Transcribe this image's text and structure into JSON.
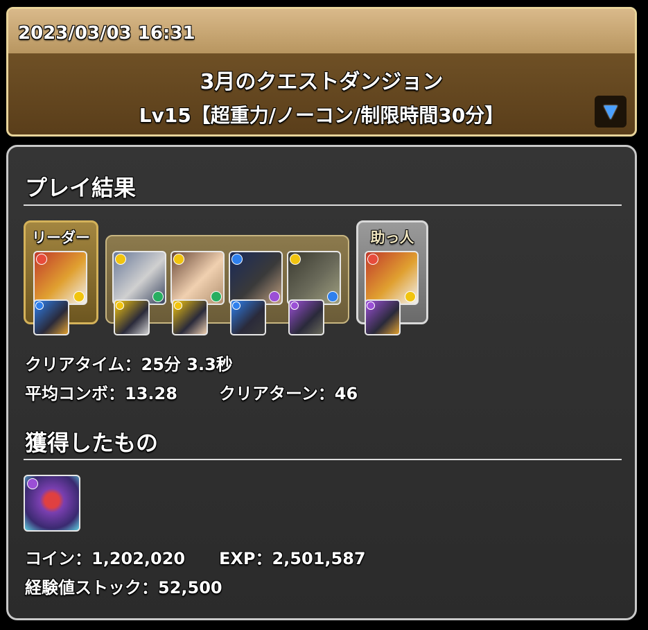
{
  "header": {
    "timestamp": "2023/03/03 16:31",
    "quest_title": "3月のクエストダンジョン",
    "quest_subtitle": "Lv15【超重力/ノーコン/制限時間30分】",
    "toggle_icon": "triangle-down-icon"
  },
  "play_result": {
    "title": "プレイ結果",
    "leader_label": "リーダー",
    "helper_label": "助っ人",
    "team": [
      {
        "role": "leader",
        "main_attr": "fire",
        "sub_attr": "light",
        "assist_attr": "water",
        "colors": [
          "#c0392b",
          "#e0a030",
          "#f0f0f0"
        ]
      },
      {
        "role": "sub",
        "main_attr": "light",
        "sub_attr": "wood",
        "assist_attr": "light",
        "colors": [
          "#6a7a9a",
          "#d0d0d0",
          "#3a4560"
        ]
      },
      {
        "role": "sub",
        "main_attr": "light",
        "sub_attr": "wood",
        "assist_attr": "light",
        "colors": [
          "#6b4a3a",
          "#f0d0b0",
          "#b09070"
        ]
      },
      {
        "role": "sub",
        "main_attr": "water",
        "sub_attr": "dark",
        "assist_attr": "water",
        "colors": [
          "#1a2a5a",
          "#3a3a3a",
          "#c0a080"
        ]
      },
      {
        "role": "sub",
        "main_attr": "light",
        "sub_attr": "water",
        "assist_attr": "dark",
        "colors": [
          "#3a3a30",
          "#6a6a5a",
          "#a0a080"
        ]
      },
      {
        "role": "helper",
        "main_attr": "fire",
        "sub_attr": "light",
        "assist_attr": "dark",
        "colors": [
          "#c0392b",
          "#e0a030",
          "#f0f0f0"
        ]
      }
    ],
    "stats": {
      "clear_time": "クリアタイム：25分 3.3秒",
      "avg_combo": "平均コンボ：13.28",
      "clear_turns": "クリアターン：46"
    }
  },
  "rewards": {
    "title": "獲得したもの",
    "drop_attr": "dark",
    "coins": "コイン：1,202,020",
    "exp": "EXP：2,501,587",
    "exp_stock": "経験値ストック：52,500"
  },
  "attr_colors": {
    "fire": "#e74c3c",
    "water": "#2f80ed",
    "wood": "#27ae60",
    "light": "#f1c40f",
    "dark": "#9b4fd6"
  }
}
